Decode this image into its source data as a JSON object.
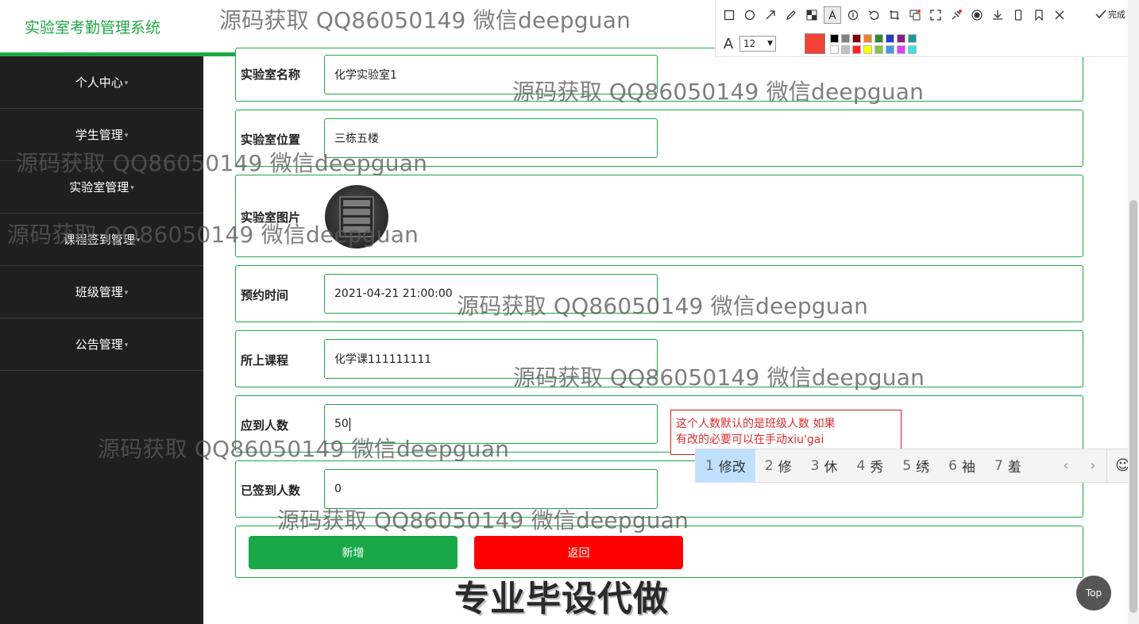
{
  "app": {
    "title": "实验室考勤管理系统"
  },
  "sidebar": {
    "items": [
      {
        "label": "个人中心"
      },
      {
        "label": "学生管理"
      },
      {
        "label": "实验室管理"
      },
      {
        "label": "课程签到管理"
      },
      {
        "label": "班级管理"
      },
      {
        "label": "公告管理"
      }
    ]
  },
  "form": {
    "lab_name": {
      "label": "实验室名称",
      "value": "化学实验室1"
    },
    "lab_location": {
      "label": "实验室位置",
      "value": "三栋五楼"
    },
    "lab_image": {
      "label": "实验室图片"
    },
    "booking_time": {
      "label": "预约时间",
      "value": "2021-04-21 21:00:00"
    },
    "course": {
      "label": "所上课程",
      "value": "化学课111111111"
    },
    "expected_count": {
      "label": "应到人数",
      "value": "50"
    },
    "signed_count": {
      "label": "已签到人数",
      "value": "0"
    },
    "add_label": "新增",
    "back_label": "返回"
  },
  "annotation": {
    "line1": "这个人数默认的是班级人数 如果",
    "line2": "有改的必要可以在手动xiu'gai"
  },
  "ime": {
    "candidates": [
      {
        "num": "1",
        "text": "修改"
      },
      {
        "num": "2",
        "text": "修"
      },
      {
        "num": "3",
        "text": "休"
      },
      {
        "num": "4",
        "text": "秀"
      },
      {
        "num": "5",
        "text": "绣"
      },
      {
        "num": "6",
        "text": "袖"
      },
      {
        "num": "7",
        "text": "羞"
      }
    ],
    "prev": "‹",
    "next": "›",
    "emoji": "☺"
  },
  "toolbar": {
    "done_label": "完成",
    "font_size": "12",
    "current_color": "#f44336",
    "palette": [
      "#000000",
      "#808080",
      "#800000",
      "#f08030",
      "#2e8b2e",
      "#1f3fbf",
      "#8b1a8b",
      "#1a9a9a",
      "#ffffff",
      "#c0c0c0",
      "#ff2020",
      "#ffff00",
      "#8bc34a",
      "#3f9be8",
      "#e040fb",
      "#40e0e0"
    ]
  },
  "watermarks": {
    "w1": "源码获取 QQ86050149 微信deepguan",
    "w2": "源码获取 QQ86050149 微信deepguan",
    "w3": "源码获取 QQ86050149 微信deepguan",
    "w4": "源码获取 QQ86050149 微信deepguan",
    "w5": "源码获取 QQ86050149 微信deepguan",
    "w6": "源码获取 QQ86050149 微信deepguan",
    "w7": "源码获取 QQ86050149 微信deepguan",
    "w8": "源码获取 QQ86050149 微信deepguan"
  },
  "slogan": "专业毕设代做",
  "top_button": "Top",
  "theme": {
    "accent": "#1ea845",
    "danger": "#ff0000",
    "sidebar_bg": "#1f1f1f"
  }
}
